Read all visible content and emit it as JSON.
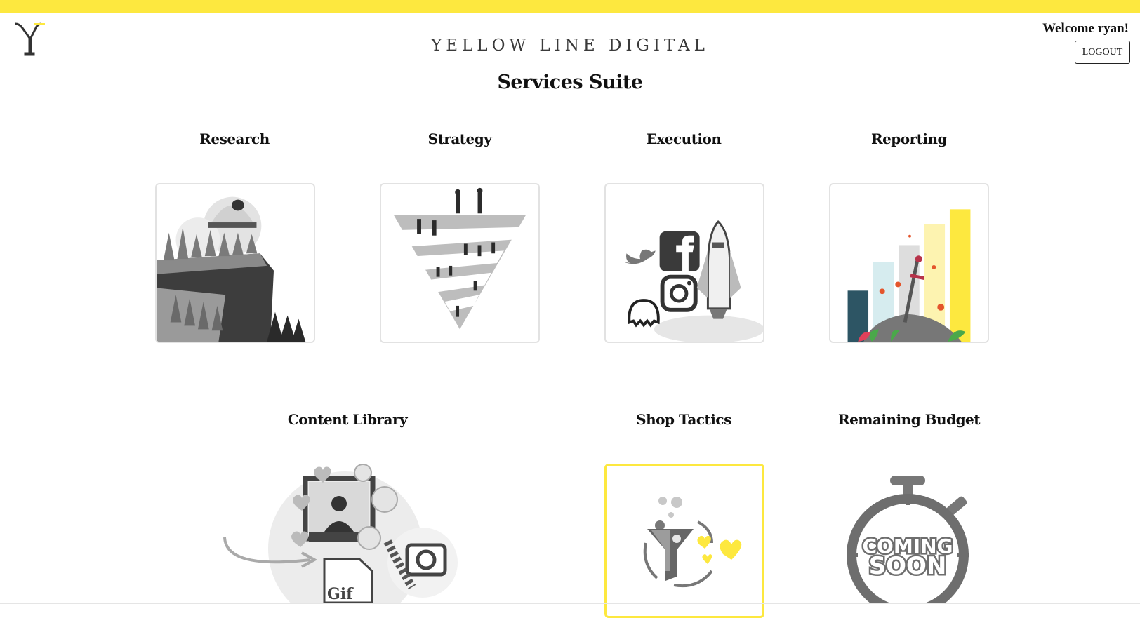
{
  "header": {
    "brand": "YELLOW LINE DIGITAL",
    "welcome": "Welcome ryan!",
    "logout_label": "LOGOUT"
  },
  "page": {
    "title": "Services Suite"
  },
  "services": [
    {
      "label": "Research",
      "icon": "observatory-cliff-icon"
    },
    {
      "label": "Strategy",
      "icon": "strategy-funnel-people-icon"
    },
    {
      "label": "Execution",
      "icon": "social-launch-rocket-icon"
    },
    {
      "label": "Reporting",
      "icon": "bar-chart-sword-icon"
    },
    {
      "label": "Content Library",
      "icon": "content-media-collage-icon"
    },
    {
      "label": "Shop Tactics",
      "icon": "funnel-hearts-icon"
    },
    {
      "label": "Remaining Budget",
      "icon": "stopwatch-coming-soon-icon",
      "badge": "COMING SOON"
    }
  ],
  "badge_lines": [
    "COMING",
    "SOON"
  ],
  "colors": {
    "accent": "#fde83f",
    "text": "#111111",
    "card_border": "#e2e2e2",
    "dark_teal": "#2d5564"
  }
}
